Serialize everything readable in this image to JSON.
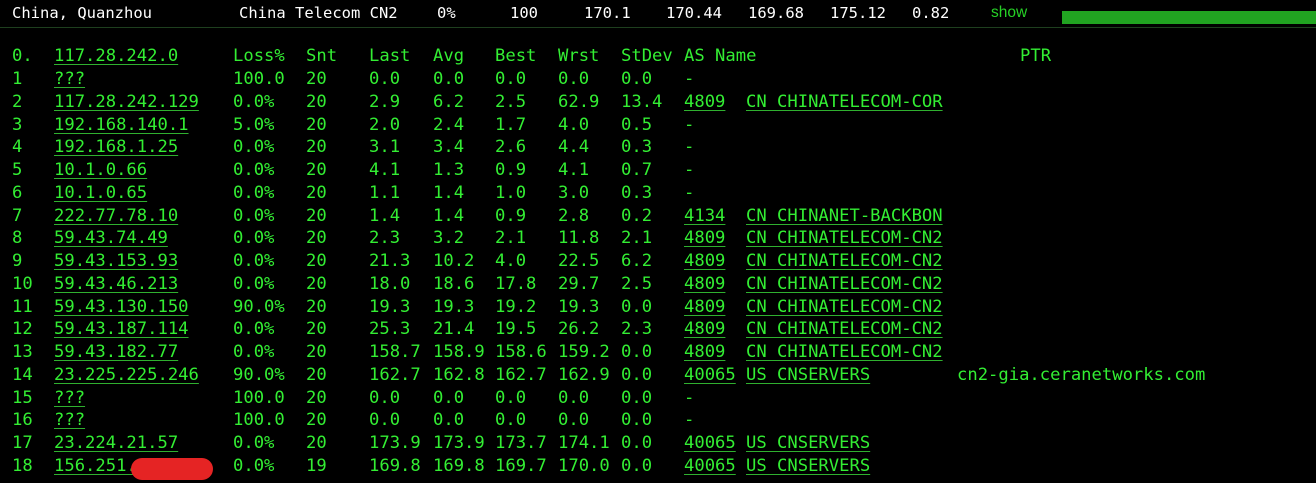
{
  "topbar": {
    "location": "China, Quanzhou",
    "isp": "China Telecom CN2",
    "loss": "0%",
    "sent": "100",
    "last": "170.1",
    "avg": "170.44",
    "best": "169.68",
    "worst": "175.12",
    "stdev": "0.82",
    "show_link": "show",
    "colors": {
      "bar": "#21a421",
      "link": "#26d126",
      "text": "#ffffff"
    }
  },
  "table": {
    "header": {
      "num": "0.",
      "host": "117.28.242.0",
      "loss": "Loss%",
      "snt": "Snt",
      "last": "Last",
      "avg": "Avg",
      "best": "Best",
      "wrst": "Wrst",
      "stdev": "StDev",
      "as_name": "AS Name",
      "ptr": "PTR"
    },
    "rows": [
      {
        "num": "1",
        "host": "???",
        "loss": "100.0",
        "snt": "20",
        "last": "0.0",
        "avg": "0.0",
        "best": "0.0",
        "wrst": "0.0",
        "stdev": "0.0",
        "as": "-",
        "as_name": "",
        "ptr": ""
      },
      {
        "num": "2",
        "host": "117.28.242.129",
        "loss": "0.0%",
        "snt": "20",
        "last": "2.9",
        "avg": "6.2",
        "best": "2.5",
        "wrst": "62.9",
        "stdev": "13.4",
        "as": "4809",
        "as_name": "CN CHINATELECOM-COR",
        "ptr": ""
      },
      {
        "num": "3",
        "host": "192.168.140.1",
        "loss": "5.0%",
        "snt": "20",
        "last": "2.0",
        "avg": "2.4",
        "best": "1.7",
        "wrst": "4.0",
        "stdev": "0.5",
        "as": "-",
        "as_name": "",
        "ptr": ""
      },
      {
        "num": "4",
        "host": "192.168.1.25",
        "loss": "0.0%",
        "snt": "20",
        "last": "3.1",
        "avg": "3.4",
        "best": "2.6",
        "wrst": "4.4",
        "stdev": "0.3",
        "as": "-",
        "as_name": "",
        "ptr": ""
      },
      {
        "num": "5",
        "host": "10.1.0.66",
        "loss": "0.0%",
        "snt": "20",
        "last": "4.1",
        "avg": "1.3",
        "best": "0.9",
        "wrst": "4.1",
        "stdev": "0.7",
        "as": "-",
        "as_name": "",
        "ptr": ""
      },
      {
        "num": "6",
        "host": "10.1.0.65",
        "loss": "0.0%",
        "snt": "20",
        "last": "1.1",
        "avg": "1.4",
        "best": "1.0",
        "wrst": "3.0",
        "stdev": "0.3",
        "as": "-",
        "as_name": "",
        "ptr": ""
      },
      {
        "num": "7",
        "host": "222.77.78.10",
        "loss": "0.0%",
        "snt": "20",
        "last": "1.4",
        "avg": "1.4",
        "best": "0.9",
        "wrst": "2.8",
        "stdev": "0.2",
        "as": "4134",
        "as_name": "CN CHINANET-BACKBON",
        "ptr": ""
      },
      {
        "num": "8",
        "host": "59.43.74.49",
        "loss": "0.0%",
        "snt": "20",
        "last": "2.3",
        "avg": "3.2",
        "best": "2.1",
        "wrst": "11.8",
        "stdev": "2.1",
        "as": "4809",
        "as_name": "CN CHINATELECOM-CN2",
        "ptr": ""
      },
      {
        "num": "9",
        "host": "59.43.153.93",
        "loss": "0.0%",
        "snt": "20",
        "last": "21.3",
        "avg": "10.2",
        "best": "4.0",
        "wrst": "22.5",
        "stdev": "6.2",
        "as": "4809",
        "as_name": "CN CHINATELECOM-CN2",
        "ptr": ""
      },
      {
        "num": "10",
        "host": "59.43.46.213",
        "loss": "0.0%",
        "snt": "20",
        "last": "18.0",
        "avg": "18.6",
        "best": "17.8",
        "wrst": "29.7",
        "stdev": "2.5",
        "as": "4809",
        "as_name": "CN CHINATELECOM-CN2",
        "ptr": ""
      },
      {
        "num": "11",
        "host": "59.43.130.150",
        "loss": "90.0%",
        "snt": "20",
        "last": "19.3",
        "avg": "19.3",
        "best": "19.2",
        "wrst": "19.3",
        "stdev": "0.0",
        "as": "4809",
        "as_name": "CN CHINATELECOM-CN2",
        "ptr": ""
      },
      {
        "num": "12",
        "host": "59.43.187.114",
        "loss": "0.0%",
        "snt": "20",
        "last": "25.3",
        "avg": "21.4",
        "best": "19.5",
        "wrst": "26.2",
        "stdev": "2.3",
        "as": "4809",
        "as_name": "CN CHINATELECOM-CN2",
        "ptr": ""
      },
      {
        "num": "13",
        "host": "59.43.182.77",
        "loss": "0.0%",
        "snt": "20",
        "last": "158.7",
        "avg": "158.9",
        "best": "158.6",
        "wrst": "159.2",
        "stdev": "0.0",
        "as": "4809",
        "as_name": "CN CHINATELECOM-CN2",
        "ptr": ""
      },
      {
        "num": "14",
        "host": "23.225.225.246",
        "loss": "90.0%",
        "snt": "20",
        "last": "162.7",
        "avg": "162.8",
        "best": "162.7",
        "wrst": "162.9",
        "stdev": "0.0",
        "as": "40065",
        "as_name": "US CNSERVERS",
        "ptr": "cn2-gia.ceranetworks.com"
      },
      {
        "num": "15",
        "host": "???",
        "loss": "100.0",
        "snt": "20",
        "last": "0.0",
        "avg": "0.0",
        "best": "0.0",
        "wrst": "0.0",
        "stdev": "0.0",
        "as": "-",
        "as_name": "",
        "ptr": ""
      },
      {
        "num": "16",
        "host": "???",
        "loss": "100.0",
        "snt": "20",
        "last": "0.0",
        "avg": "0.0",
        "best": "0.0",
        "wrst": "0.0",
        "stdev": "0.0",
        "as": "-",
        "as_name": "",
        "ptr": ""
      },
      {
        "num": "17",
        "host": "23.224.21.57",
        "loss": "0.0%",
        "snt": "20",
        "last": "173.9",
        "avg": "173.9",
        "best": "173.7",
        "wrst": "174.1",
        "stdev": "0.0",
        "as": "40065",
        "as_name": "US CNSERVERS",
        "ptr": ""
      },
      {
        "num": "18",
        "host": "156.251.",
        "loss": "0.0%",
        "snt": "19",
        "last": "169.8",
        "avg": "169.8",
        "best": "169.7",
        "wrst": "170.0",
        "stdev": "0.0",
        "as": "40065",
        "as_name": "US CNSERVERS",
        "ptr": "",
        "redacted": true
      }
    ]
  }
}
